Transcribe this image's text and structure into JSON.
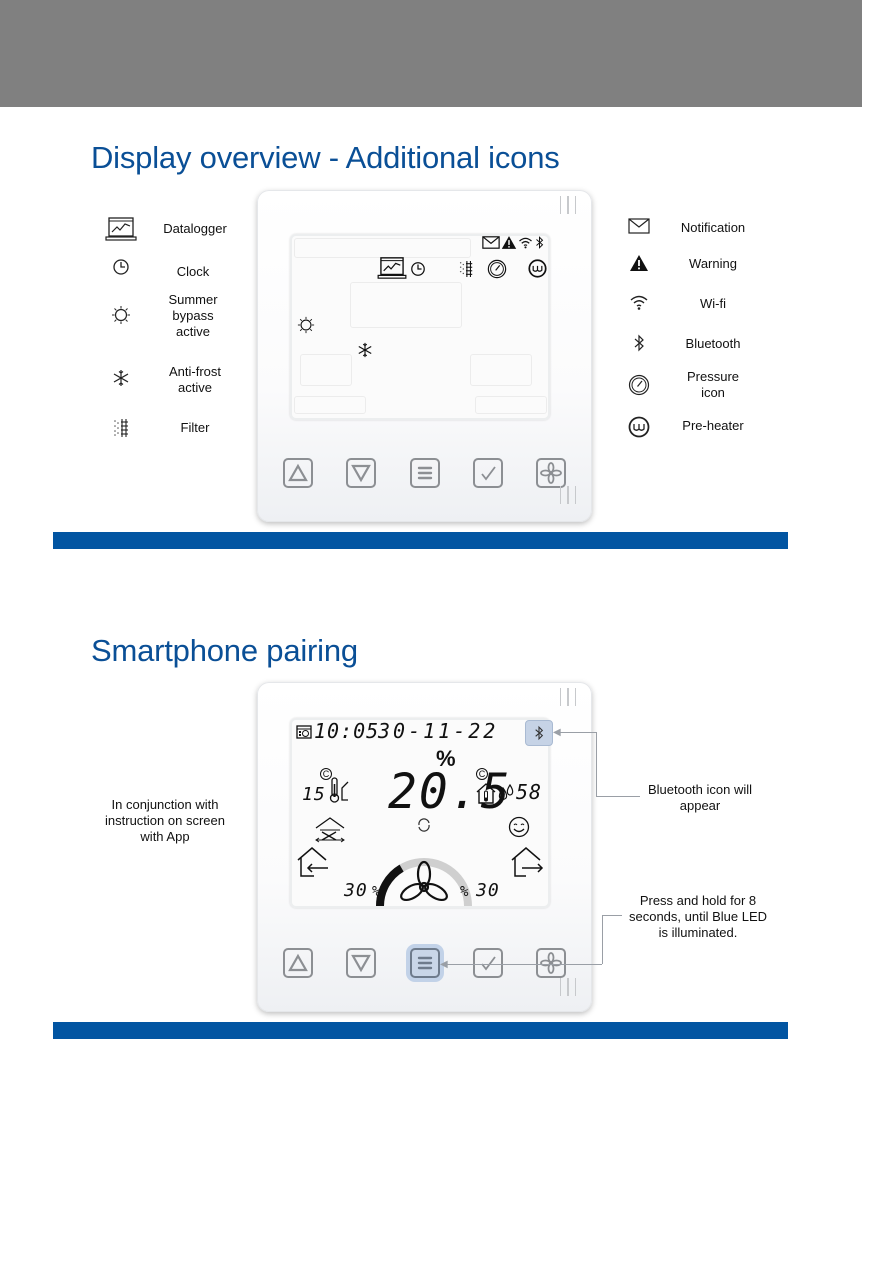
{
  "sections": [
    {
      "title": "Display overview - Additional icons",
      "legend_left": [
        {
          "icon": "datalogger-icon",
          "label": "Datalogger"
        },
        {
          "icon": "clock-icon",
          "label": "Clock"
        },
        {
          "icon": "sun-icon",
          "label": "Summer\nbypass\nactive"
        },
        {
          "icon": "snowflake-icon",
          "label": "Anti-frost\nactive"
        },
        {
          "icon": "filter-icon",
          "label": "Filter"
        }
      ],
      "legend_right": [
        {
          "icon": "envelope-icon",
          "label": "Notification"
        },
        {
          "icon": "warning-icon",
          "label": "Warning"
        },
        {
          "icon": "wifi-icon",
          "label": "Wi-fi"
        },
        {
          "icon": "bluetooth-icon",
          "label": "Bluetooth"
        },
        {
          "icon": "pressure-gauge-icon",
          "label": "Pressure\nicon"
        },
        {
          "icon": "pre-heater-icon",
          "label": "Pre-heater"
        }
      ]
    },
    {
      "title": "Smartphone pairing",
      "lcd": {
        "time": "10:05",
        "date": "30-11-22",
        "percent_symbol": "%",
        "outdoor_temp": "15",
        "indoor_temp": "20.5",
        "temp_unit": "C",
        "humidity": "58",
        "supply_percent": "30",
        "extract_percent": "30",
        "percent_unit": "%",
        "fan_level": 0.33
      },
      "annotations": {
        "left": "In conjunction with\ninstruction on screen\nwith App",
        "bluetooth": "Bluetooth icon will\nappear",
        "button": "Press and hold for 8\nseconds, until Blue LED\nis illuminated."
      }
    }
  ],
  "device_buttons": [
    {
      "icon": "up-arrow-icon",
      "name": "up-button"
    },
    {
      "icon": "down-arrow-icon",
      "name": "down-button"
    },
    {
      "icon": "menu-icon",
      "name": "menu-button"
    },
    {
      "icon": "check-icon",
      "name": "confirm-button"
    },
    {
      "icon": "fan-icon",
      "name": "fan-button"
    }
  ],
  "colors": {
    "header_gray": "#808080",
    "title_blue": "#0a4f96",
    "rule_blue": "#0255a2",
    "highlight_blue": "#c6d3e6"
  }
}
